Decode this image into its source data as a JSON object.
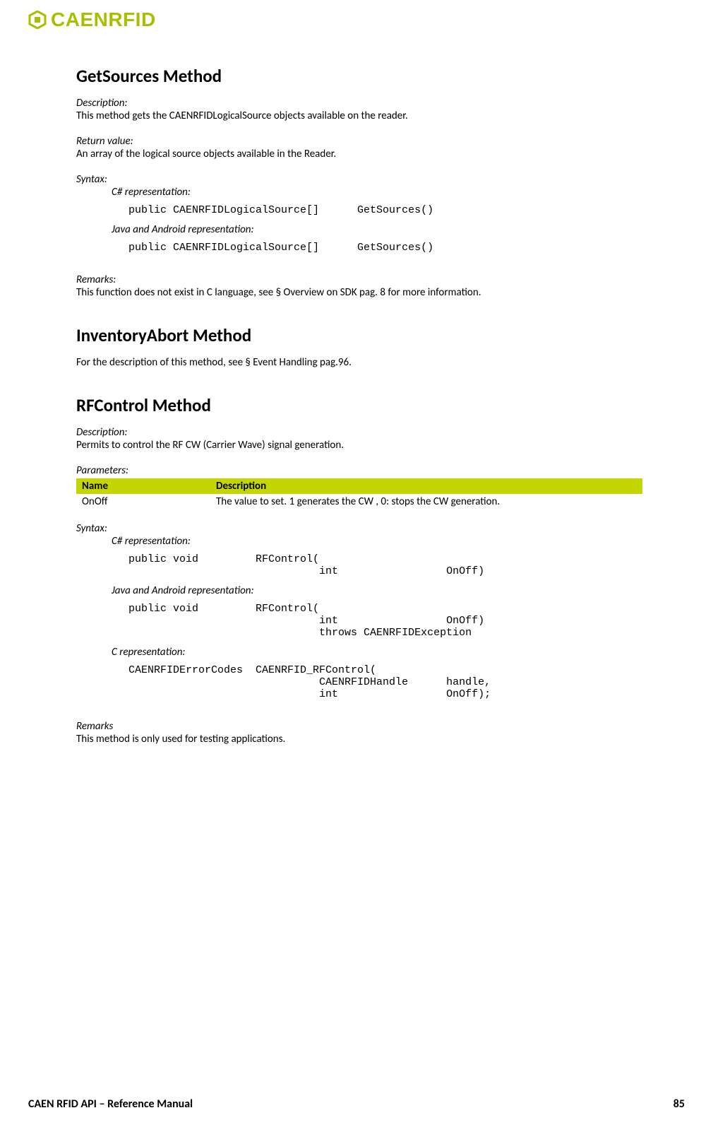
{
  "header": {
    "brand": "CAENRFID"
  },
  "section1": {
    "title": "GetSources Method",
    "desc_label": "Description:",
    "desc_text": "This method gets the CAENRFIDLogicalSource objects available on the reader.",
    "ret_label": "Return value:",
    "ret_text": "An array of the logical source objects available in the Reader.",
    "syntax_label": "Syntax:",
    "cs_label": "C# representation:",
    "cs_code": "public CAENRFIDLogicalSource[]      GetSources()",
    "java_label": "Java and Android representation:",
    "java_code": "public CAENRFIDLogicalSource[]      GetSources()",
    "remarks_label": "Remarks:",
    "remarks_text": "This function does not exist in C language, see § Overview on SDK pag. 8 for more information."
  },
  "section2": {
    "title": "InventoryAbort Method",
    "text": "For the description of this method, see § Event Handling pag.96."
  },
  "section3": {
    "title": "RFControl Method",
    "desc_label": "Description:",
    "desc_text": "Permits to control the RF CW (Carrier Wave) signal generation.",
    "params_label": "Parameters:",
    "table": {
      "h1": "Name",
      "h2": "Description",
      "r1c1": "OnOff",
      "r1c2": "The value to set. 1 generates the CW , 0: stops the CW generation."
    },
    "syntax_label": "Syntax:",
    "cs_label": "C# representation:",
    "cs_code": "public void         RFControl(\n                              int                 OnOff)",
    "java_label": "Java and Android representation:",
    "java_code": "public void         RFControl(\n                              int                 OnOff)\n                              throws CAENRFIDException",
    "c_label": "C representation:",
    "c_code": "CAENRFIDErrorCodes  CAENRFID_RFControl(\n                              CAENRFIDHandle      handle,\n                              int                 OnOff);",
    "remarks_label": "Remarks",
    "remarks_text": "This method is only used for testing applications."
  },
  "footer": {
    "left": "CAEN RFID API – Reference Manual",
    "right": "85"
  }
}
